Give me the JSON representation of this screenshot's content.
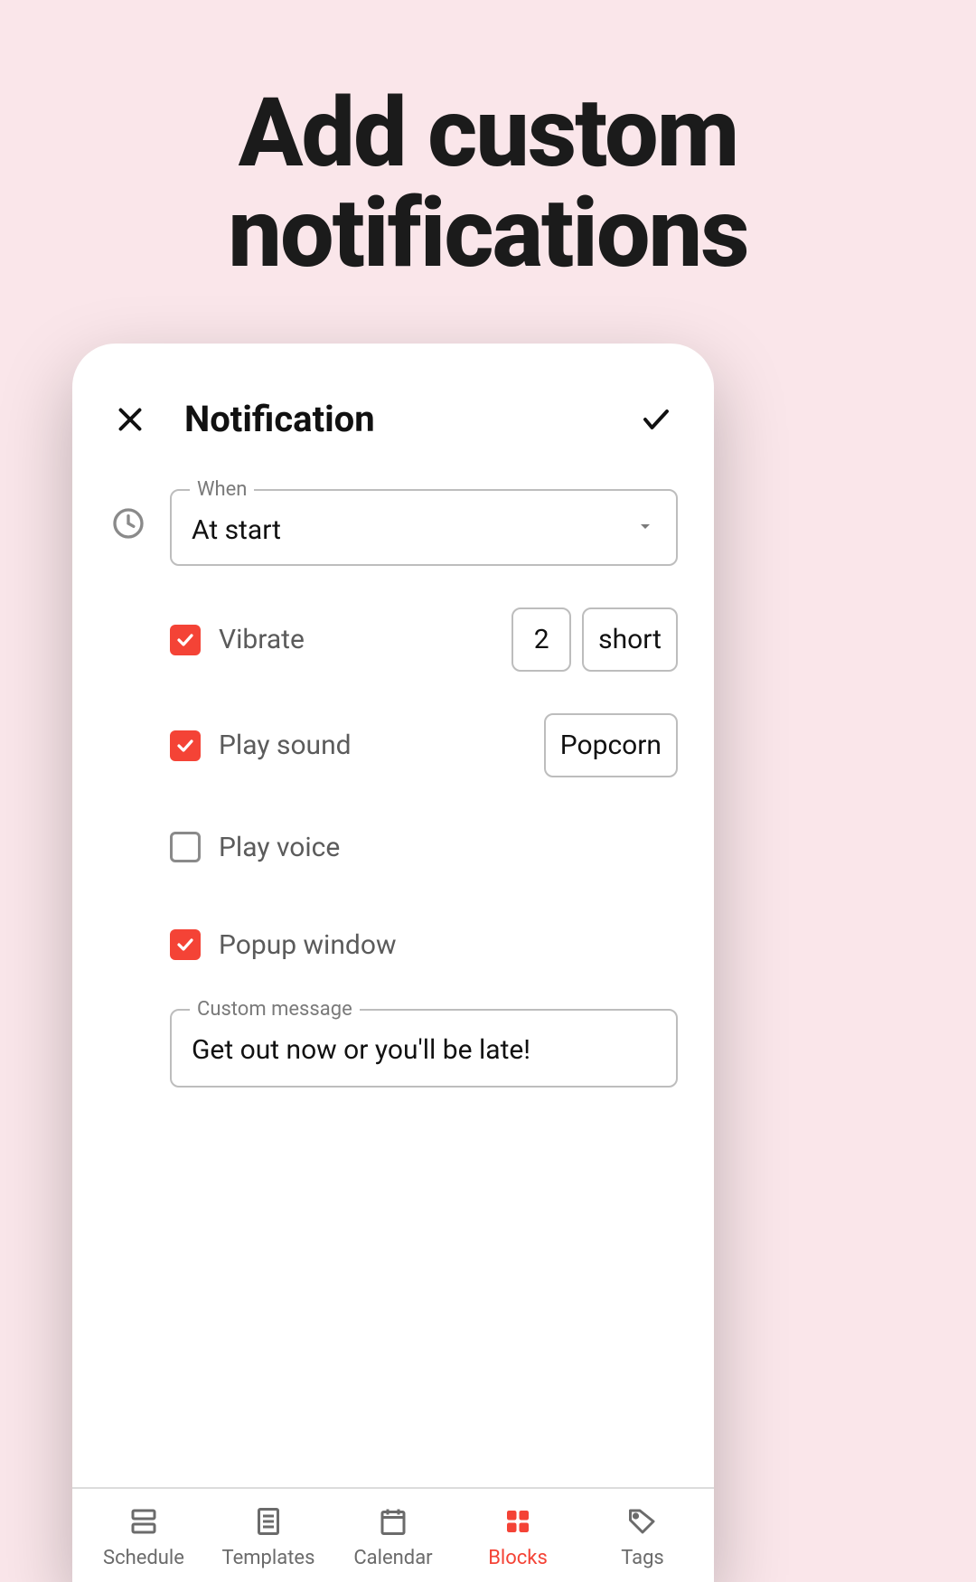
{
  "promo": {
    "title_line1": "Add custom",
    "title_line2": "notifications"
  },
  "header": {
    "title": "Notification"
  },
  "form": {
    "when": {
      "label": "When",
      "value": "At start"
    },
    "vibrate": {
      "label": "Vibrate",
      "checked": true,
      "count": "2",
      "duration": "short"
    },
    "play_sound": {
      "label": "Play sound",
      "checked": true,
      "sound": "Popcorn"
    },
    "play_voice": {
      "label": "Play voice",
      "checked": false
    },
    "popup": {
      "label": "Popup window",
      "checked": true
    },
    "custom_message": {
      "label": "Custom message",
      "value": "Get out now or you'll be late!"
    }
  },
  "nav": {
    "items": [
      {
        "label": "Schedule"
      },
      {
        "label": "Templates"
      },
      {
        "label": "Calendar"
      },
      {
        "label": "Blocks"
      },
      {
        "label": "Tags"
      }
    ]
  },
  "colors": {
    "accent": "#f44336"
  }
}
